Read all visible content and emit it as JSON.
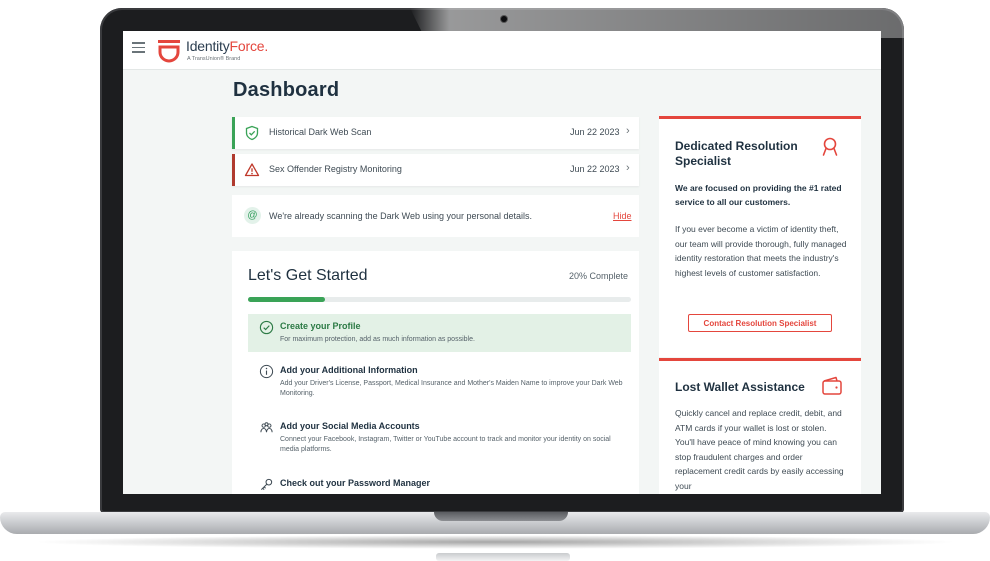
{
  "app": {
    "brand_main": "Identity",
    "brand_accent": "Force",
    "brand_mark": ".",
    "brand_sub": "A TransUnion® Brand"
  },
  "page": {
    "title": "Dashboard"
  },
  "alerts": [
    {
      "label": "Historical Dark Web Scan",
      "date": "Jun 22 2023",
      "status": "ok",
      "icon": "shield-check-icon"
    },
    {
      "label": "Sex Offender Registry Monitoring",
      "date": "Jun 22 2023",
      "status": "warning",
      "icon": "warning-triangle-icon"
    }
  ],
  "notice": {
    "icon": "fingerprint-icon",
    "message": "We're already scanning the Dark Web using your personal details.",
    "hide_label": "Hide"
  },
  "getting_started": {
    "title": "Let's Get Started",
    "progress_label": "20% Complete",
    "progress": 0.2,
    "steps": [
      {
        "title": "Create your Profile",
        "desc": "For maximum protection, add as much information as possible.",
        "icon": "check-circle-icon",
        "done": true
      },
      {
        "title": "Add your Additional Information",
        "desc": "Add your Driver's License, Passport, Medical Insurance and Mother's Maiden Name to improve your Dark Web Monitoring.",
        "icon": "info-circle-icon",
        "done": false
      },
      {
        "title": "Add your Social Media Accounts",
        "desc": "Connect your Facebook, Instagram, Twitter or YouTube account to track and monitor your identity on social media platforms.",
        "icon": "people-icon",
        "done": false
      },
      {
        "title": "Check out your Password Manager",
        "desc": "",
        "icon": "key-icon",
        "done": false
      }
    ]
  },
  "resolution": {
    "title": "Dedicated Resolution Specialist",
    "icon": "specialist-badge-icon",
    "strong": "We are focused on providing the #1 rated service to all our customers.",
    "body": "If you ever become a victim of identity theft, our team will provide thorough, fully managed identity restoration that meets the industry's highest levels of customer satisfaction.",
    "button": "Contact Resolution Specialist"
  },
  "wallet": {
    "title": "Lost Wallet Assistance",
    "icon": "wallet-icon",
    "body": "Quickly cancel and replace credit, debit, and ATM cards if your wallet is lost or stolen. You'll have peace of mind knowing you can stop fraudulent charges and order replacement credit cards by easily accessing your"
  },
  "colors": {
    "accent": "#e4463d",
    "success": "#3aa357",
    "navy": "#1f3140",
    "warning": "#c0392b"
  }
}
